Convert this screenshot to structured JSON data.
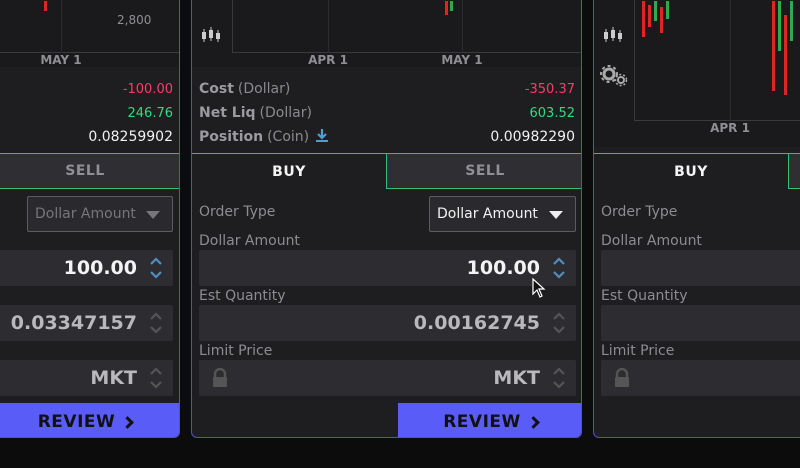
{
  "left_panel": {
    "chart": {
      "x_ticks": [
        "MAY 1"
      ],
      "y_label": "2,800"
    },
    "stats": {
      "cost_value": "-100.00",
      "net_liq_value": "246.76",
      "position_value": "0.08259902"
    },
    "tabs": {
      "sell": "SELL"
    },
    "order_type_select": "Dollar Amount",
    "dollar_amount_value": "100.00",
    "est_quantity_value": "0.03347157",
    "limit_price_value": "MKT",
    "review_label": "REVIEW"
  },
  "mid_panel": {
    "chart": {
      "x_ticks": [
        "APR 1",
        "MAY 1"
      ]
    },
    "stats": {
      "cost_label": "Cost",
      "cost_unit": "(Dollar)",
      "cost_value": "-350.37",
      "net_liq_label": "Net Liq",
      "net_liq_unit": "(Dollar)",
      "net_liq_value": "603.52",
      "position_label": "Position",
      "position_unit": "(Coin)",
      "position_value": "0.00982290"
    },
    "tabs": {
      "buy": "BUY",
      "sell": "SELL"
    },
    "order_type_label": "Order Type",
    "order_type_select": "Dollar Amount",
    "dollar_amount_label": "Dollar Amount",
    "dollar_amount_value": "100.00",
    "est_quantity_label": "Est Quantity",
    "est_quantity_value": "0.00162745",
    "limit_price_label": "Limit Price",
    "limit_price_value": "MKT",
    "review_label": "REVIEW"
  },
  "right_panel": {
    "chart": {
      "x_ticks": [
        "APR 1"
      ]
    },
    "tabs": {
      "buy": "BUY"
    },
    "order_type_label": "Order Type",
    "dollar_amount_label": "Dollar Amount",
    "est_quantity_label": "Est Quantity",
    "limit_price_label": "Limit Price"
  },
  "colors": {
    "accent": "#5a5cf7",
    "positive": "#2fdc7d",
    "negative": "#ff3a68",
    "tab_border": "#31c173"
  }
}
